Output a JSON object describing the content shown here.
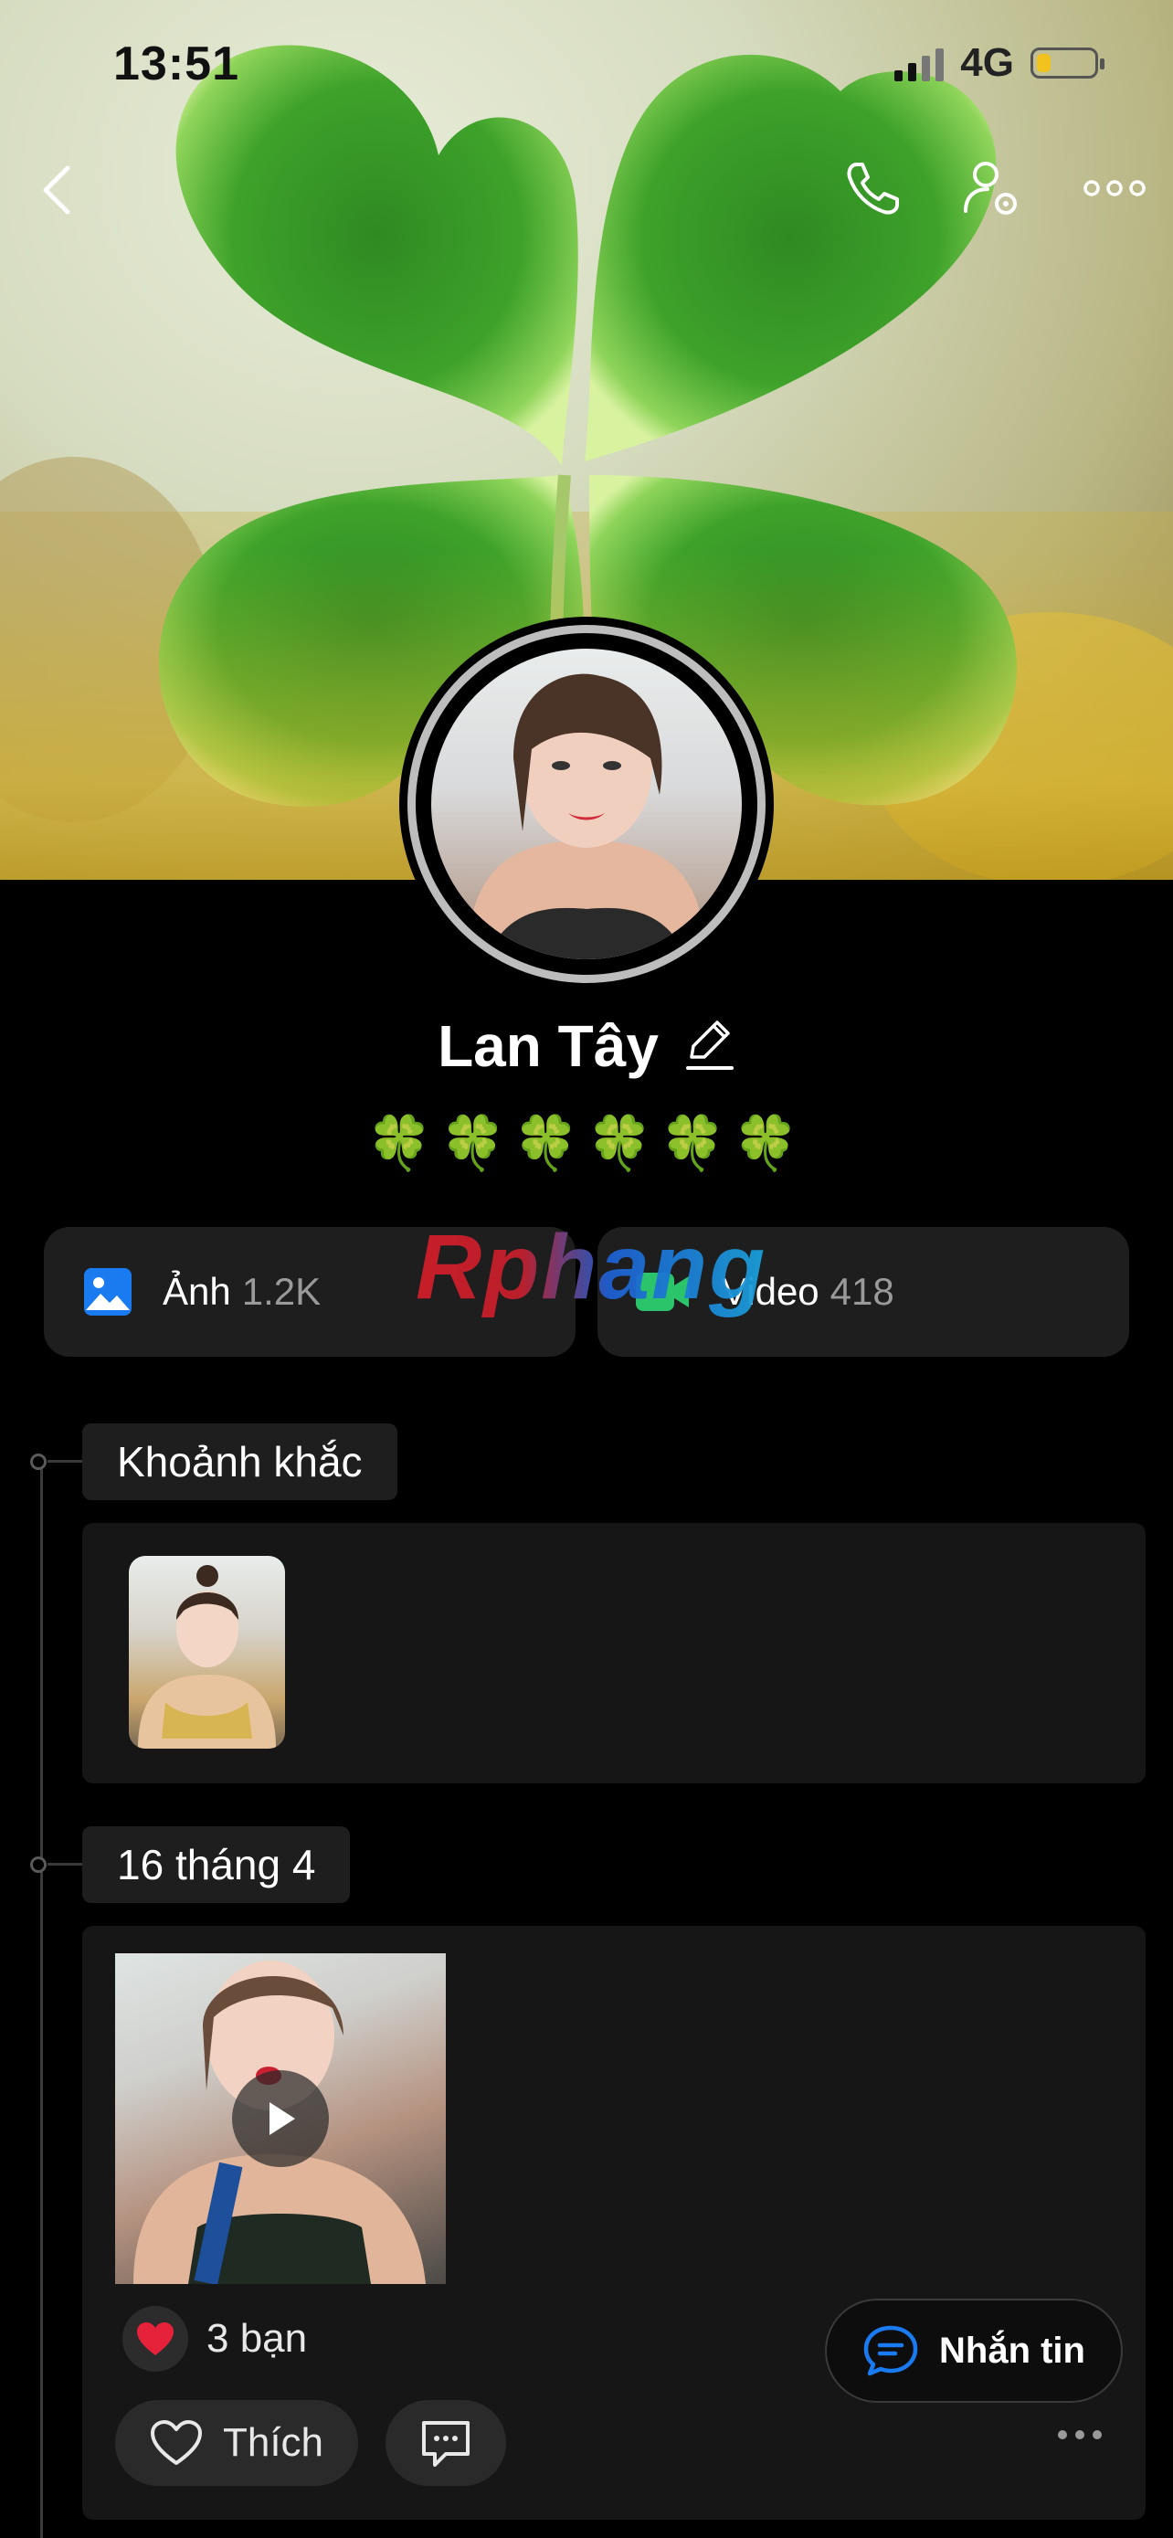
{
  "status_bar": {
    "time": "13:51",
    "network": "4G",
    "battery_level": 0.25
  },
  "colors": {
    "accent_blue": "#1a7bf0",
    "video_green": "#2bc46a",
    "heart_red": "#e6223a",
    "battery_yellow": "#f2c21e",
    "background": "#000000"
  },
  "header": {
    "icons": [
      "back-arrow-icon",
      "phone-icon",
      "user-settings-icon",
      "more-horizontal-icon"
    ]
  },
  "profile": {
    "name": "Lan Tây",
    "bio_emoji": "🍀🍀🍀🍀🍀🍀"
  },
  "media": {
    "photos": {
      "label": "Ảnh",
      "count": "1.2K"
    },
    "videos": {
      "label": "Video",
      "count": "418"
    }
  },
  "watermark": "Rphang",
  "timeline": {
    "moments_label": "Khoảnh khắc",
    "date_label": "16 tháng 4"
  },
  "post": {
    "reaction_count": "3 bạn",
    "like_label": "Thích"
  },
  "message_button": {
    "label": "Nhắn tin"
  }
}
